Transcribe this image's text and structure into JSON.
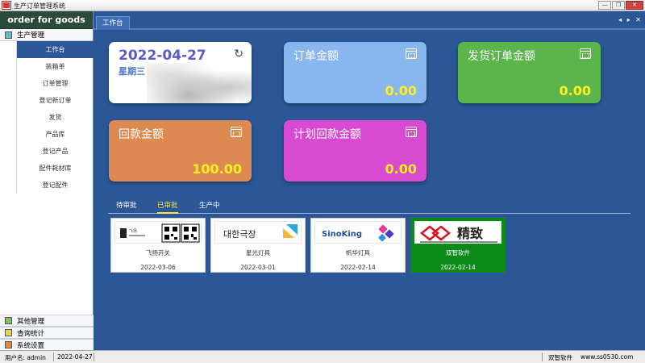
{
  "window": {
    "title": "生产订单管理系统",
    "buttons": [
      "—",
      "❐",
      "✕"
    ]
  },
  "sidebar": {
    "brand": "order for goods",
    "group_main": {
      "label": "生产管理",
      "color": "#5bc0c8"
    },
    "items": [
      {
        "label": "工作台",
        "active": true
      },
      {
        "label": "装箱单"
      },
      {
        "label": "订单管理"
      },
      {
        "label": "登记新订单"
      },
      {
        "label": "发货"
      },
      {
        "label": "产品库"
      },
      {
        "label": "登记产品"
      },
      {
        "label": "配件耗材库"
      },
      {
        "label": "登记配件"
      }
    ],
    "bottom_groups": [
      {
        "label": "其他管理",
        "color": "#7cc45a"
      },
      {
        "label": "查询统计",
        "color": "#f0d24a"
      },
      {
        "label": "系统设置",
        "color": "#e8873a"
      }
    ]
  },
  "tabs": {
    "active": "工作台",
    "arrows": "◂ ▸ ✕"
  },
  "dashboard": {
    "date": "2022-04-27",
    "weekday": "星期三",
    "refresh_icon": "↻",
    "cards": [
      {
        "title": "订单金额",
        "value": "0.00",
        "color": "#87b7ee"
      },
      {
        "title": "发货订单金额",
        "value": "0.00",
        "color": "#5bb54a"
      },
      {
        "title": "回款金额",
        "value": "100.00",
        "color": "#dd8a52"
      },
      {
        "title": "计划回款金额",
        "value": "0.00",
        "color": "#d94ad2"
      }
    ]
  },
  "order_tabs": [
    {
      "label": "待审批"
    },
    {
      "label": "已审批",
      "active": true
    },
    {
      "label": "生产中"
    }
  ],
  "orders": [
    {
      "name": "飞扬开关",
      "date": "2022-03-06",
      "logo": "飞扬",
      "selected": false
    },
    {
      "name": "星光灯具",
      "date": "2022-03-01",
      "logo": "대한극장",
      "selected": false
    },
    {
      "name": "帆华灯具",
      "date": "2022-02-14",
      "logo": "SinoKing",
      "selected": false
    },
    {
      "name": "双智软件",
      "date": "2022-02-14",
      "logo": "精致",
      "selected": true
    }
  ],
  "status": {
    "user_label": "用户名: admin",
    "date": "2022-04-27",
    "company": "双智软件",
    "site": "www.ss0530.com"
  }
}
